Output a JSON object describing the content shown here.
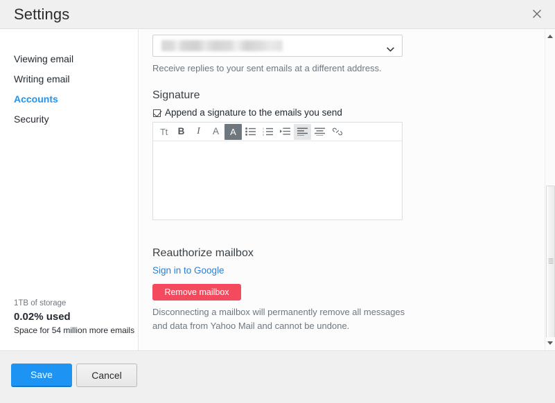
{
  "window": {
    "title": "Settings",
    "close_icon": "close-icon"
  },
  "sidebar": {
    "items": [
      {
        "label": "Viewing email",
        "active": false
      },
      {
        "label": "Writing email",
        "active": false
      },
      {
        "label": "Accounts",
        "active": true
      },
      {
        "label": "Security",
        "active": false
      }
    ],
    "storage": {
      "capacity": "1TB of storage",
      "used": "0.02% used",
      "space": "Space for 54 million more emails"
    }
  },
  "main": {
    "reply_to": {
      "selected_value": "",
      "value_redacted": true,
      "chevron_icon": "chevron-down-icon",
      "help_text": "Receive replies to your sent emails at a different address."
    },
    "signature": {
      "title": "Signature",
      "checkbox_label": "Append a signature to the emails you send",
      "checkbox_checked": true,
      "editor_value": "",
      "toolbar": [
        {
          "name": "font-size-icon",
          "glyph": "Tt",
          "state": "normal"
        },
        {
          "name": "bold-icon",
          "glyph": "B",
          "state": "normal"
        },
        {
          "name": "italic-icon",
          "glyph": "I",
          "state": "normal"
        },
        {
          "name": "font-family-icon",
          "glyph": "A",
          "state": "normal"
        },
        {
          "name": "text-color-icon",
          "glyph": "A",
          "state": "active-dark"
        },
        {
          "name": "bulleted-list-icon",
          "glyph": "",
          "state": "normal"
        },
        {
          "name": "numbered-list-icon",
          "glyph": "",
          "state": "normal"
        },
        {
          "name": "indent-icon",
          "glyph": "",
          "state": "normal"
        },
        {
          "name": "align-left-icon",
          "glyph": "",
          "state": "active-light"
        },
        {
          "name": "align-center-icon",
          "glyph": "",
          "state": "normal"
        },
        {
          "name": "insert-link-icon",
          "glyph": "",
          "state": "normal"
        }
      ]
    },
    "reauthorize": {
      "title": "Reauthorize mailbox",
      "link_label": "Sign in to Google",
      "remove_button_label": "Remove mailbox",
      "warning_text": "Disconnecting a mailbox will permanently remove all messages and data from Yahoo Mail and cannot be undone."
    }
  },
  "footer": {
    "save_label": "Save",
    "cancel_label": "Cancel"
  },
  "scrollbar": {
    "up_icon": "scroll-up-arrow-icon",
    "down_icon": "scroll-down-arrow-icon",
    "thumb": "scrollbar-thumb"
  },
  "colors": {
    "accent_blue": "#1d94f3",
    "link_blue": "#2a7fd4",
    "danger_red": "#f44a5e",
    "header_bg": "#f0f0f0",
    "text_primary": "#232a31",
    "text_muted": "#6e7780"
  }
}
